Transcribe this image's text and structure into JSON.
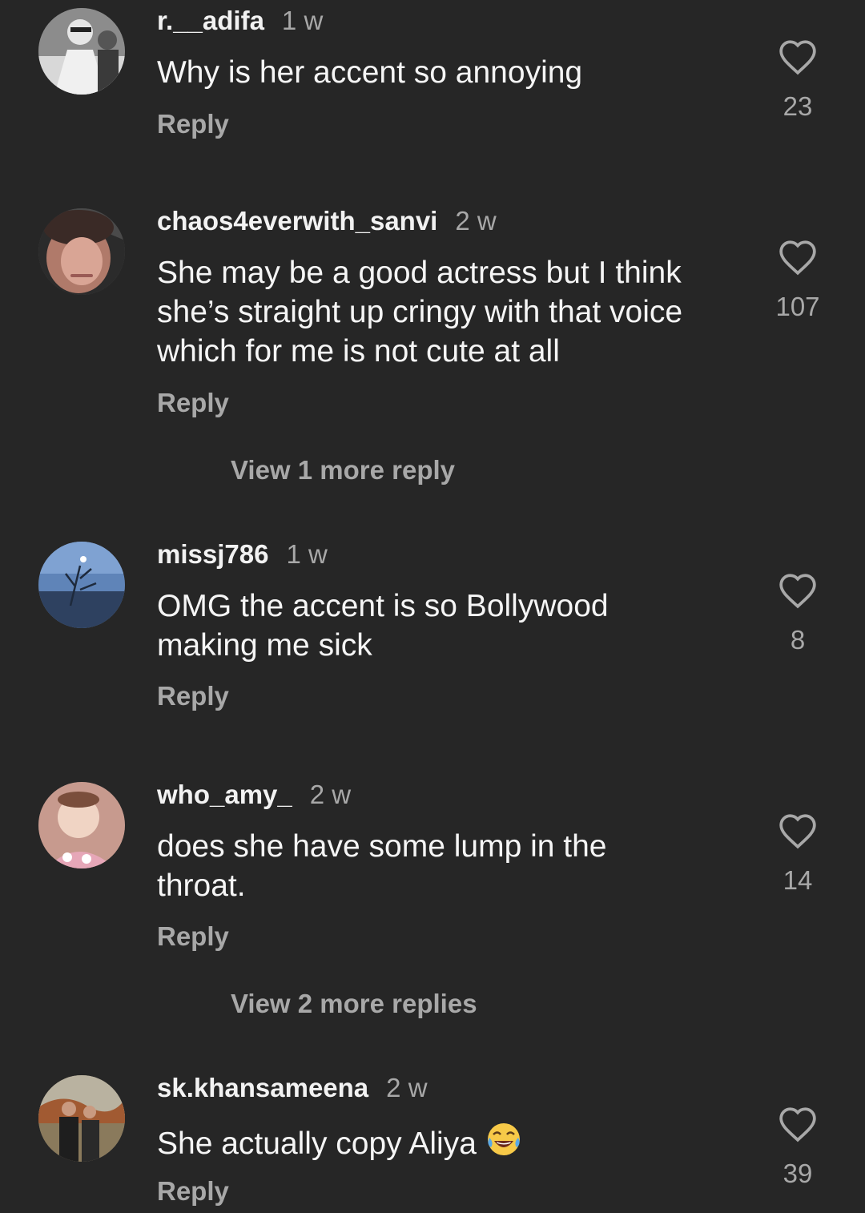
{
  "comments": [
    {
      "username": "r.__adifa",
      "time": "1 w",
      "text": "Why is her accent so annoying",
      "reply_label": "Reply",
      "likes": "23",
      "avatar_icon": "avatar-photo-bw-portrait"
    },
    {
      "username": "chaos4everwith_sanvi",
      "time": "2 w",
      "text": "She may be a good actress but I think she’s straight up cringy with that voice which for me is not cute at all",
      "reply_label": "Reply",
      "likes": "107",
      "avatar_icon": "avatar-photo-selfie",
      "view_more": "View 1 more reply"
    },
    {
      "username": "missj786",
      "time": "1 w",
      "text": "OMG the accent is so Bollywood making me sick",
      "reply_label": "Reply",
      "likes": "8",
      "avatar_icon": "avatar-photo-sky-tree"
    },
    {
      "username": "who_amy_",
      "time": "2 w",
      "text": "does she have some lump in the throat.",
      "reply_label": "Reply",
      "likes": "14",
      "avatar_icon": "avatar-photo-baby",
      "view_more": "View 2 more replies"
    },
    {
      "username": "sk.khansameena",
      "time": "2 w",
      "text": "She actually copy Aliya",
      "text_emoji": "😂",
      "reply_label": "Reply",
      "likes": "39",
      "avatar_icon": "avatar-photo-couple"
    }
  ],
  "colors": {
    "background": "#262626",
    "primary_text": "#f5f5f5",
    "secondary_text": "#a8a8a8"
  }
}
